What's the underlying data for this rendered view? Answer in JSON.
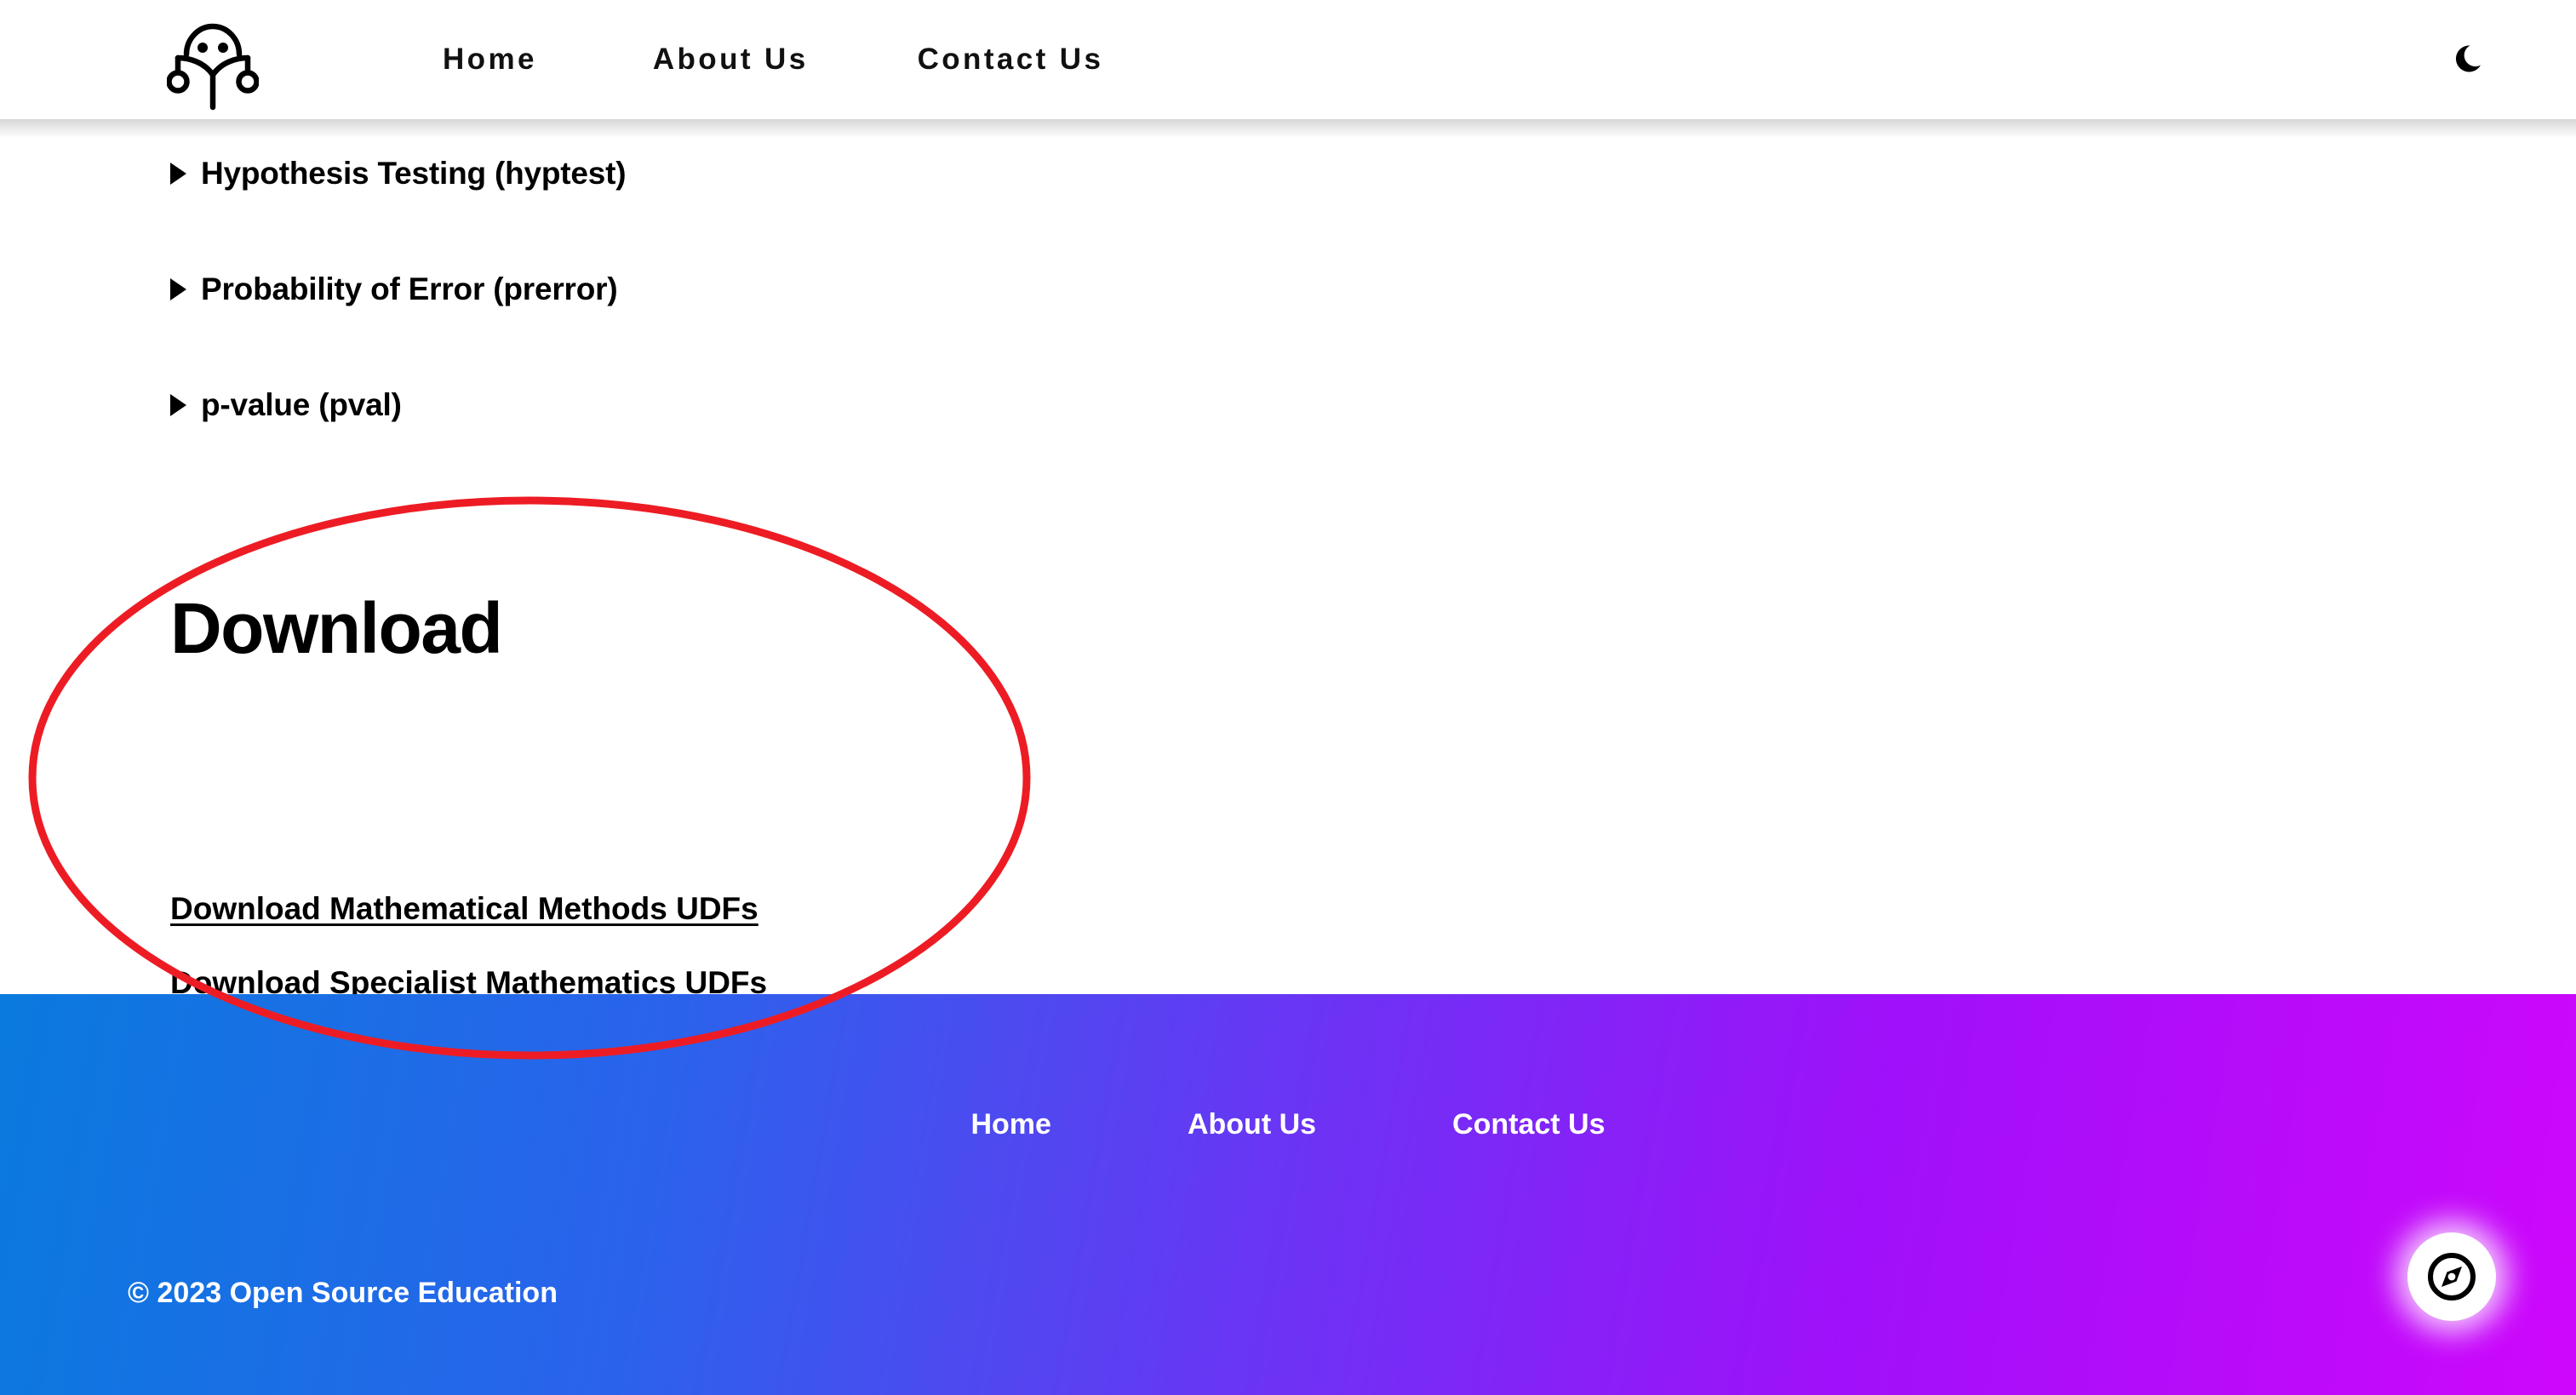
{
  "header": {
    "logo_icon": "person-reading-book-logo",
    "nav": [
      {
        "label": "Home"
      },
      {
        "label": "About Us"
      },
      {
        "label": "Contact Us"
      }
    ],
    "theme_toggle_icon": "moon-icon"
  },
  "main": {
    "details": [
      {
        "marker_icon": "triangle-right-icon",
        "label": "Hypothesis Testing (hyptest)"
      },
      {
        "marker_icon": "triangle-right-icon",
        "label": "Probability of Error (prerror)"
      },
      {
        "marker_icon": "triangle-right-icon",
        "label": "p-value (pval)"
      }
    ],
    "download_heading": "Download",
    "download_links": [
      {
        "label": "Download Mathematical Methods UDFs"
      },
      {
        "label": "Download Specialist Mathematics UDFs"
      }
    ]
  },
  "annotation": {
    "shape": "ellipse",
    "color": "#ed1c24"
  },
  "footer": {
    "nav": [
      {
        "label": "Home"
      },
      {
        "label": "About Us"
      },
      {
        "label": "Contact Us"
      }
    ],
    "copyright": "© 2023 Open Source Education",
    "gradient_start": "#0a7ade",
    "gradient_end": "#ce07fb"
  },
  "float_button": {
    "icon": "compass-icon"
  }
}
